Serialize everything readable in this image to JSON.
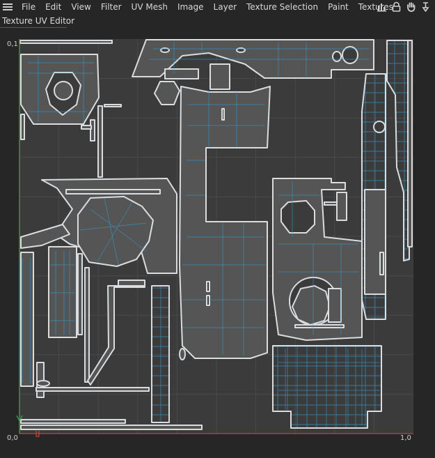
{
  "menu": {
    "items": [
      "File",
      "Edit",
      "View",
      "Filter",
      "UV Mesh",
      "Image",
      "Layer",
      "Texture Selection",
      "Paint",
      "Textures"
    ]
  },
  "toolbar_icons": [
    "bar-chart-icon",
    "lock-icon",
    "hand-icon",
    "pin-icon"
  ],
  "panel": {
    "title": "Texture UV Editor"
  },
  "axes": {
    "y_top_label": "0,1",
    "origin_label": "0,0",
    "x_end_label": "1,0",
    "x_axis_color": "#c84040",
    "y_axis_color": "#3fae4a"
  },
  "colors": {
    "background": "#262626",
    "uv_space": "#3b3b3b",
    "island_fill": "#555555",
    "island_edge": "#d9dde0",
    "wire": "#2f9fd6",
    "grid": "#4a4a4a"
  }
}
